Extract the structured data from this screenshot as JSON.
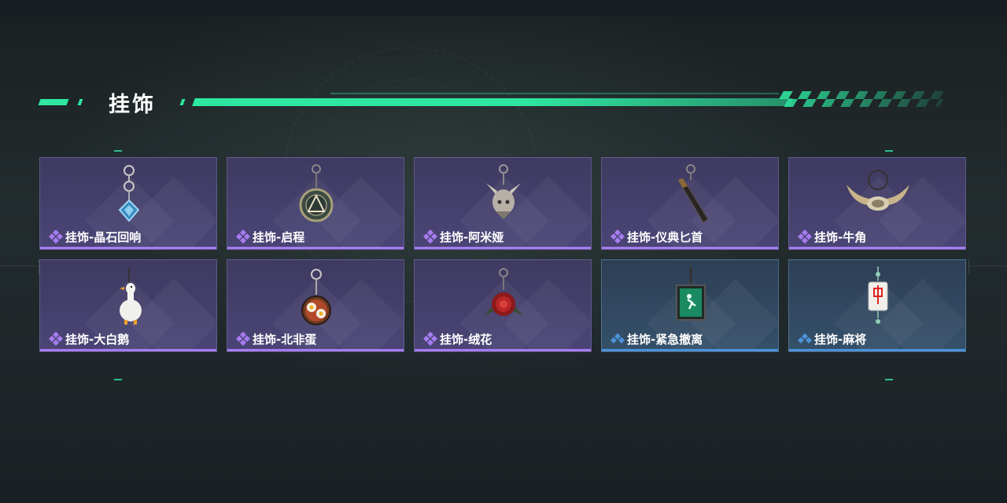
{
  "header": {
    "title": "挂饰"
  },
  "colors": {
    "accent": "#2ee7a0",
    "rarity_purple": "#a77cf0",
    "rarity_blue": "#4c93d8"
  },
  "items": [
    {
      "label": "挂饰-晶石回响",
      "rarity": "purple",
      "icon": "crystal-pendant-icon"
    },
    {
      "label": "挂饰-启程",
      "rarity": "purple",
      "icon": "medallion-pendant-icon"
    },
    {
      "label": "挂饰-阿米娅",
      "rarity": "purple",
      "icon": "figure-pendant-icon"
    },
    {
      "label": "挂饰-仪典匕首",
      "rarity": "purple",
      "icon": "dagger-pendant-icon"
    },
    {
      "label": "挂饰-牛角",
      "rarity": "purple",
      "icon": "horns-pendant-icon"
    },
    {
      "label": "挂饰-大白鹅",
      "rarity": "purple",
      "icon": "goose-pendant-icon"
    },
    {
      "label": "挂饰-北非蛋",
      "rarity": "purple",
      "icon": "shakshuka-pendant-icon"
    },
    {
      "label": "挂饰-绒花",
      "rarity": "purple",
      "icon": "rose-pendant-icon"
    },
    {
      "label": "挂饰-紧急撤离",
      "rarity": "blue",
      "icon": "exit-sign-pendant-icon"
    },
    {
      "label": "挂饰-麻将",
      "rarity": "blue",
      "icon": "mahjong-pendant-icon"
    }
  ]
}
